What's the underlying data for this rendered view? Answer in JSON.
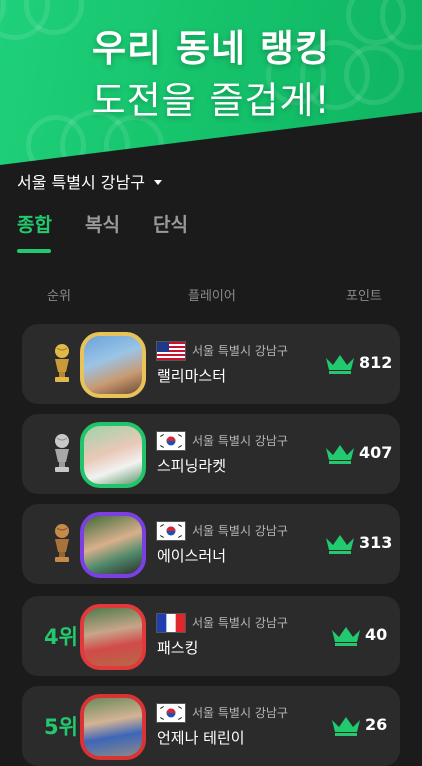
{
  "banner": {
    "line1": "우리 동네 랭킹",
    "line2": "도전을 즐겁게!"
  },
  "location": {
    "label": "서울 특별시 강남구"
  },
  "tabs": [
    {
      "label": "종합",
      "active": true
    },
    {
      "label": "복식",
      "active": false
    },
    {
      "label": "단식",
      "active": false
    }
  ],
  "columns": {
    "rank": "순위",
    "player": "플레이어",
    "points": "포인트"
  },
  "colors": {
    "accent": "#22c96e",
    "gold": "#d9b44a",
    "silver": "#bfbfbf",
    "bronze": "#b8823f"
  },
  "rankings": [
    {
      "rank": 1,
      "rank_label": "",
      "trophy": "gold-trophy-icon",
      "avatar_border": "#e8c35a",
      "flag": "us-flag-icon",
      "region": "서울 특별시 강남구",
      "name": "랠리마스터",
      "points": "812"
    },
    {
      "rank": 2,
      "rank_label": "",
      "trophy": "silver-trophy-icon",
      "avatar_border": "#21c46a",
      "flag": "kr-flag-icon",
      "region": "서울 특별시 강남구",
      "name": "스피닝라켓",
      "points": "407"
    },
    {
      "rank": 3,
      "rank_label": "",
      "trophy": "bronze-trophy-icon",
      "avatar_border": "#7b3fe4",
      "flag": "kr-flag-icon",
      "region": "서울 특별시 강남구",
      "name": "에이스러너",
      "points": "313"
    },
    {
      "rank": 4,
      "rank_label": "4위",
      "trophy": "",
      "avatar_border": "#e23a3a",
      "flag": "fr-flag-icon",
      "region": "서울 특별시 강남구",
      "name": "패스킹",
      "points": "40"
    },
    {
      "rank": 5,
      "rank_label": "5위",
      "trophy": "",
      "avatar_border": "#d93333",
      "flag": "kr-flag-icon",
      "region": "서울 특별시 강남구",
      "name": "언제나 테린이",
      "points": "26"
    }
  ]
}
